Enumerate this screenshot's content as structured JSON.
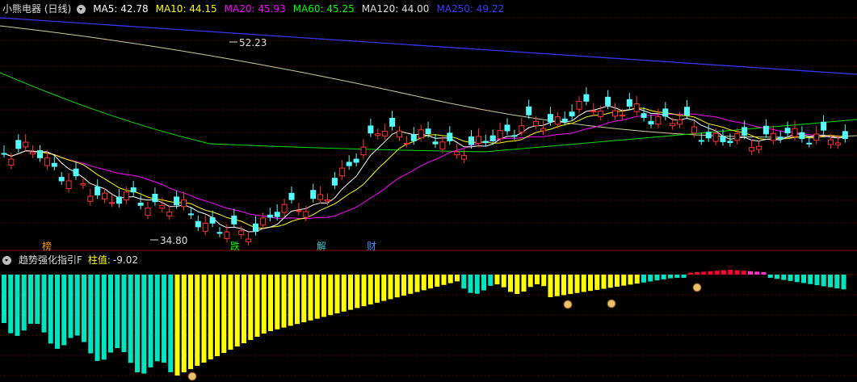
{
  "header": {
    "title": "小熊电器 (日线)",
    "ma_labels": [
      {
        "text": "MA5: 42.78",
        "color": "#ffffff"
      },
      {
        "text": "MA10: 44.15",
        "color": "#ffff00"
      },
      {
        "text": "MA20: 45.93",
        "color": "#ff00ff"
      },
      {
        "text": "MA60: 45.25",
        "color": "#00ff00"
      },
      {
        "text": "MA120: 44.00",
        "color": "#dddddd"
      },
      {
        "text": "MA250: 49.22",
        "color": "#3a3aff"
      }
    ]
  },
  "indicator": {
    "title": "趋势强化指引F",
    "value_label": "柱值:",
    "value": "-9.02"
  },
  "chart_data": [
    {
      "type": "candlestick",
      "title": "小熊电器 (日线)",
      "annotations": {
        "high_label": "52.23",
        "low_label": "34.80"
      },
      "markers": [
        {
          "text": "榜",
          "color": "#ff9900"
        },
        {
          "text": "跌",
          "color": "#00ff00"
        },
        {
          "text": "解",
          "color": "#33cccc"
        },
        {
          "text": "财",
          "color": "#3399ff"
        }
      ],
      "colors": {
        "up": "#ff3232",
        "down": "#54fcfc"
      }
    },
    {
      "type": "bar",
      "title": "趋势强化指引F",
      "last_value": -9.02,
      "colors": {
        "negative_strong": "#00e5c0",
        "negative_weak": "#ffff00",
        "positive": "#ff0033",
        "positive_weak": "#ff33cc"
      }
    }
  ]
}
